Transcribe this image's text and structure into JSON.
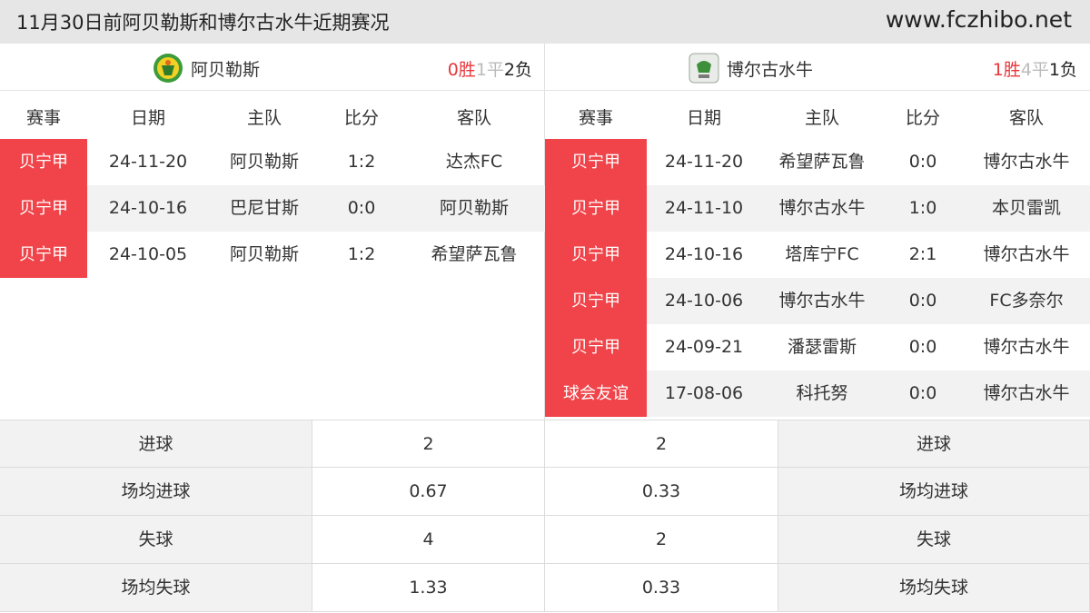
{
  "header": {
    "title": "11月30日前阿贝勒斯和博尔古水牛近期赛况",
    "site": "www.fczhibo.net"
  },
  "columns": [
    "赛事",
    "日期",
    "主队",
    "比分",
    "客队"
  ],
  "left": {
    "team": "阿贝勒斯",
    "logo_icon": "abelhas-team-logo",
    "record": {
      "win": "0胜",
      "draw": "1平",
      "loss": "2负"
    },
    "matches": [
      {
        "comp": "贝宁甲",
        "date": "24-11-20",
        "home": "阿贝勒斯",
        "score": "1:2",
        "away": "达杰FC"
      },
      {
        "comp": "贝宁甲",
        "date": "24-10-16",
        "home": "巴尼甘斯",
        "score": "0:0",
        "away": "阿贝勒斯"
      },
      {
        "comp": "贝宁甲",
        "date": "24-10-05",
        "home": "阿贝勒斯",
        "score": "1:2",
        "away": "希望萨瓦鲁"
      }
    ]
  },
  "right": {
    "team": "博尔古水牛",
    "logo_icon": "buffles-du-borgou-team-logo",
    "record": {
      "win": "1胜",
      "draw": "4平",
      "loss": "1负"
    },
    "matches": [
      {
        "comp": "贝宁甲",
        "date": "24-11-20",
        "home": "希望萨瓦鲁",
        "score": "0:0",
        "away": "博尔古水牛"
      },
      {
        "comp": "贝宁甲",
        "date": "24-11-10",
        "home": "博尔古水牛",
        "score": "1:0",
        "away": "本贝雷凯"
      },
      {
        "comp": "贝宁甲",
        "date": "24-10-16",
        "home": "塔库宁FC",
        "score": "2:1",
        "away": "博尔古水牛"
      },
      {
        "comp": "贝宁甲",
        "date": "24-10-06",
        "home": "博尔古水牛",
        "score": "0:0",
        "away": "FC多奈尔"
      },
      {
        "comp": "贝宁甲",
        "date": "24-09-21",
        "home": "潘瑟雷斯",
        "score": "0:0",
        "away": "博尔古水牛"
      },
      {
        "comp": "球会友谊",
        "date": "17-08-06",
        "home": "科托努",
        "score": "0:0",
        "away": "博尔古水牛"
      }
    ]
  },
  "stats": [
    {
      "label": "进球",
      "left": "2",
      "right": "2"
    },
    {
      "label": "场均进球",
      "left": "0.67",
      "right": "0.33"
    },
    {
      "label": "失球",
      "left": "4",
      "right": "2"
    },
    {
      "label": "场均失球",
      "left": "1.33",
      "right": "0.33"
    }
  ],
  "colors": {
    "competition_badge": "#f0444a",
    "win": "#e8373c",
    "draw": "#bbbbbb",
    "header_bg": "#e6e6e6"
  }
}
